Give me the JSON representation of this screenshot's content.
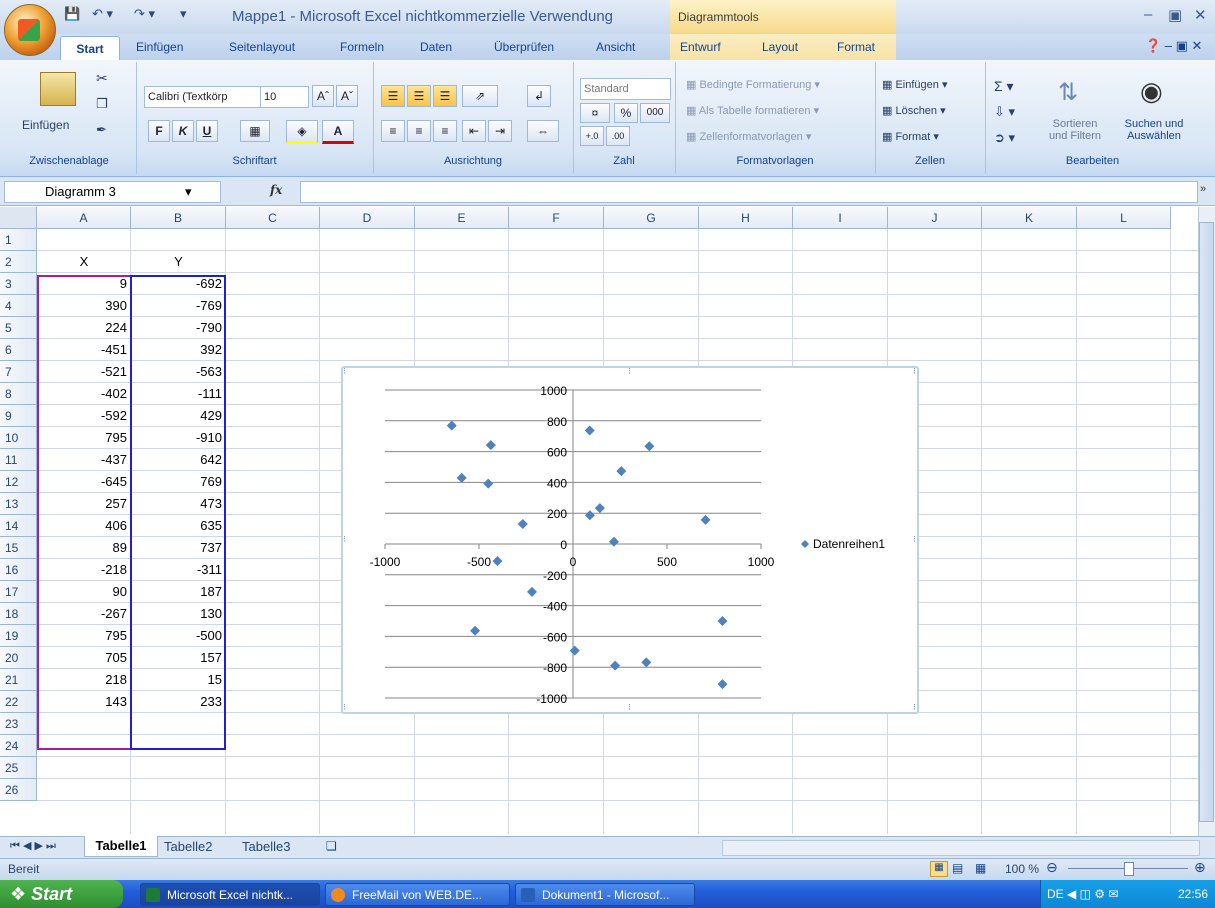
{
  "title_bar": {
    "app_title": "Mappe1 - Microsoft Excel nichtkommerzielle Verwendung",
    "context_title": "Diagrammtools"
  },
  "tabs": [
    "Start",
    "Einfügen",
    "Seitenlayout",
    "Formeln",
    "Daten",
    "Überprüfen",
    "Ansicht"
  ],
  "context_tabs": [
    "Entwurf",
    "Layout",
    "Format"
  ],
  "ribbon": {
    "clipboard": {
      "paste": "Einfügen",
      "group": "Zwischenablage"
    },
    "font": {
      "name": "Calibri (Textkörp",
      "size": "10",
      "bold": "F",
      "italic": "K",
      "underline": "U",
      "group": "Schriftart"
    },
    "alignment": {
      "group": "Ausrichtung"
    },
    "number": {
      "format": "Standard",
      "percent": "%",
      "thousands": "000",
      "group": "Zahl"
    },
    "styles": {
      "conditional": "Bedingte Formatierung",
      "as_table": "Als Tabelle formatieren",
      "cell_styles": "Zellenformatvorlagen",
      "group": "Formatvorlagen"
    },
    "cells": {
      "insert": "Einfügen",
      "delete": "Löschen",
      "format": "Format",
      "group": "Zellen"
    },
    "editing": {
      "sort1": "Sortieren",
      "sort2": "und Filtern",
      "find1": "Suchen und",
      "find2": "Auswählen",
      "group": "Bearbeiten"
    }
  },
  "formula_bar": {
    "name_box": "Diagramm 3",
    "fx": "fx"
  },
  "columns": [
    "A",
    "B",
    "C",
    "D",
    "E",
    "F",
    "G",
    "H",
    "I",
    "J",
    "K",
    "L"
  ],
  "rows": [
    "1",
    "2",
    "3",
    "4",
    "5",
    "6",
    "7",
    "8",
    "9",
    "10",
    "11",
    "12",
    "13",
    "14",
    "15",
    "16",
    "17",
    "18",
    "19",
    "20",
    "21",
    "22",
    "23",
    "24",
    "25",
    "26"
  ],
  "table": {
    "header_x": "X",
    "header_y": "Y",
    "x": [
      "9",
      "390",
      "224",
      "-451",
      "-521",
      "-402",
      "-592",
      "795",
      "-437",
      "-645",
      "257",
      "406",
      "89",
      "-218",
      "90",
      "-267",
      "795",
      "705",
      "218",
      "143"
    ],
    "y": [
      "-692",
      "-769",
      "-790",
      "392",
      "-563",
      "-111",
      "429",
      "-910",
      "642",
      "769",
      "473",
      "635",
      "737",
      "-311",
      "187",
      "130",
      "-500",
      "157",
      "15",
      "233"
    ]
  },
  "chart_data": {
    "type": "scatter",
    "series": [
      {
        "name": "Datenreihen1",
        "x": [
          9,
          390,
          224,
          -451,
          -521,
          -402,
          -592,
          795,
          -437,
          -645,
          257,
          406,
          89,
          -218,
          90,
          -267,
          795,
          705,
          218,
          143
        ],
        "y": [
          -692,
          -769,
          -790,
          392,
          -563,
          -111,
          429,
          -910,
          642,
          769,
          473,
          635,
          737,
          -311,
          187,
          130,
          -500,
          157,
          15,
          233
        ]
      }
    ],
    "xlim": [
      -1000,
      1000
    ],
    "ylim": [
      -1000,
      1000
    ],
    "x_ticks": [
      "-1000",
      "-500",
      "0",
      "500",
      "1000"
    ],
    "y_ticks": [
      "1000",
      "800",
      "600",
      "400",
      "200",
      "0",
      "-200",
      "-400",
      "-600",
      "-800",
      "-1000"
    ],
    "grid": "horizontal",
    "legend": "right",
    "marker_color": "#4f81bd"
  },
  "sheet_tabs": [
    "Tabelle1",
    "Tabelle2",
    "Tabelle3"
  ],
  "status": {
    "ready": "Bereit",
    "zoom": "100 %"
  },
  "taskbar": {
    "start": "Start",
    "tasks": [
      "Microsoft Excel nichtk...",
      "FreeMail von WEB.DE...",
      "Dokument1 - Microsof..."
    ],
    "lang": "DE",
    "clock": "22:56"
  }
}
